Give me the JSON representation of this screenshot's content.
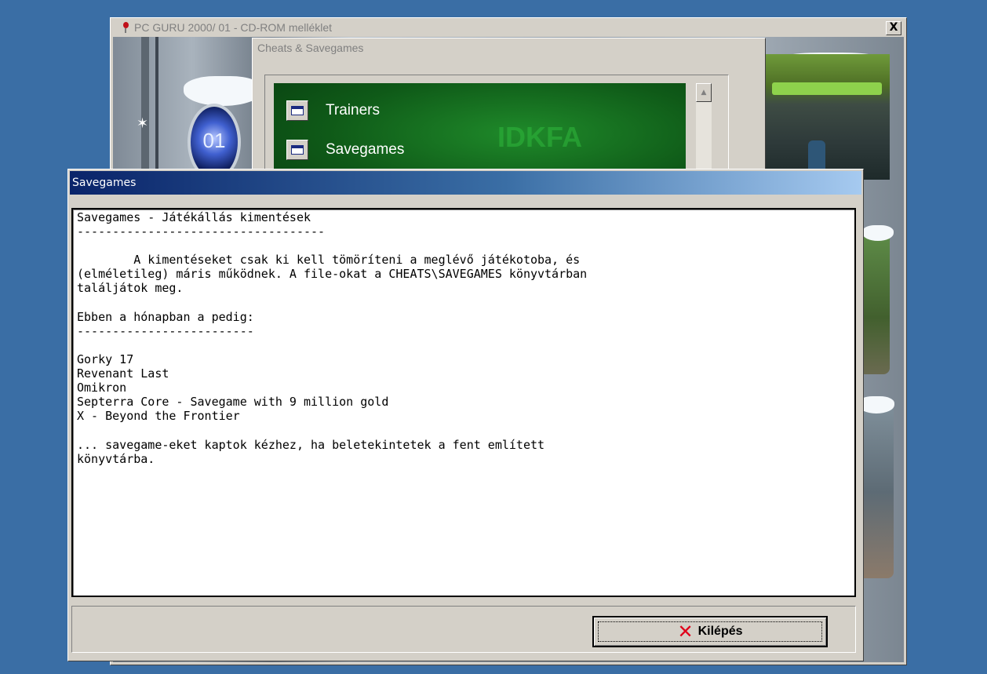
{
  "main_window": {
    "title": "PC GURU 2000/ 01 - CD-ROM melléklet",
    "close_label": "X",
    "art_label": "01"
  },
  "cheats_window": {
    "title": "Cheats & Savegames",
    "watermark": "IDKFA",
    "items": [
      {
        "label": "Trainers",
        "icon": "document-icon"
      },
      {
        "label": "Savegames",
        "icon": "document-icon"
      }
    ],
    "scroll_up_glyph": "▲"
  },
  "savegames_window": {
    "title": "Savegames",
    "text_lines": [
      "Savegames - Játékállás kimentések",
      "-----------------------------------",
      "",
      "        A kimentéseket csak ki kell tömöríteni a meglévő játékotoba, és",
      "(elméletileg) máris működnek. A file-okat a CHEATS\\SAVEGAMES könyvtárban",
      "találjátok meg.",
      "",
      "Ebben a hónapban a pedig:",
      "-------------------------",
      "",
      "Gorky 17",
      "Revenant Last",
      "Omikron",
      "Septerra Core - Savegame with 9 million gold",
      "X - Beyond the Frontier",
      "",
      "... savegame-eket kaptok kézhez, ha beletekintetek a fent említett",
      "könyvtárba."
    ],
    "exit_button": {
      "label": "Kilépés",
      "icon": "red-x-icon",
      "icon_glyph": "✕"
    }
  }
}
